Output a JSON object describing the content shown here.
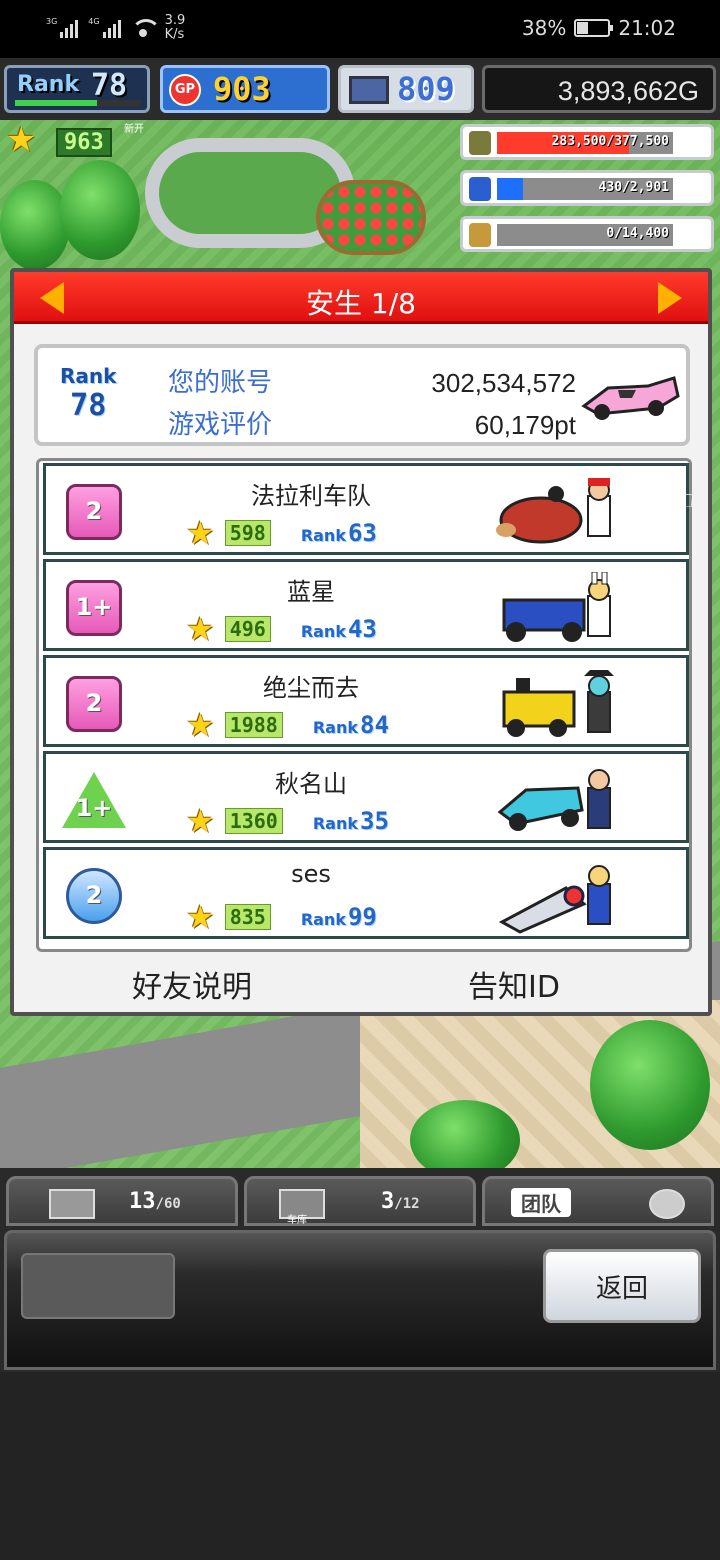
{
  "status_bar": {
    "network1": "3G",
    "network2": "4G",
    "speed_value": "3.9",
    "speed_unit": "K/s",
    "battery": "38%",
    "time": "21:02"
  },
  "hud": {
    "rank_label": "Rank",
    "rank_value": "78",
    "rank_progress": 0.65,
    "gp_icon_label": "GP",
    "gp_value": "903",
    "research_value": "809",
    "money": "3,893,662G",
    "star_value": "963",
    "star_tag": "新开",
    "resources": [
      {
        "name": "fuel",
        "text": "283,500/377,500",
        "fill": 0.75,
        "color": "#ff3b2b"
      },
      {
        "name": "water",
        "text": "430/2,901",
        "fill": 0.15,
        "color": "#1f6fff"
      },
      {
        "name": "crop",
        "text": "0/14,400",
        "fill": 0.0,
        "color": "#9aa"
      }
    ]
  },
  "dialog": {
    "title": "安生 1/8",
    "account": {
      "rank_label": "Rank",
      "rank_value": "78",
      "account_label": "您的账号",
      "account_value": "302,534,572",
      "rating_label": "游戏评价",
      "rating_value": "60,179pt"
    },
    "friends": [
      {
        "badge": "2",
        "badge_style": "pink",
        "name": "法拉利车队",
        "stars": "598",
        "rank_label": "Rank",
        "rank": "63"
      },
      {
        "badge": "1+",
        "badge_style": "pink",
        "name": "蓝星",
        "stars": "496",
        "rank_label": "Rank",
        "rank": "43"
      },
      {
        "badge": "2",
        "badge_style": "pink",
        "name": "绝尘而去",
        "stars": "1988",
        "rank_label": "Rank",
        "rank": "84"
      },
      {
        "badge": "1+",
        "badge_style": "green",
        "name": "秋名山",
        "stars": "1360",
        "rank_label": "Rank",
        "rank": "35"
      },
      {
        "badge": "2",
        "badge_style": "blue",
        "name": "ses",
        "stars": "835",
        "rank_label": "Rank",
        "rank": "99"
      }
    ],
    "footer": {
      "friend_help": "好友说明",
      "notify_id": "告知ID"
    }
  },
  "bottom": {
    "tab1_count": "13",
    "tab1_max": "60",
    "garage_label": "车库",
    "tab2_count": "3",
    "tab2_max": "12",
    "team_label": "团队",
    "back_label": "返回"
  }
}
